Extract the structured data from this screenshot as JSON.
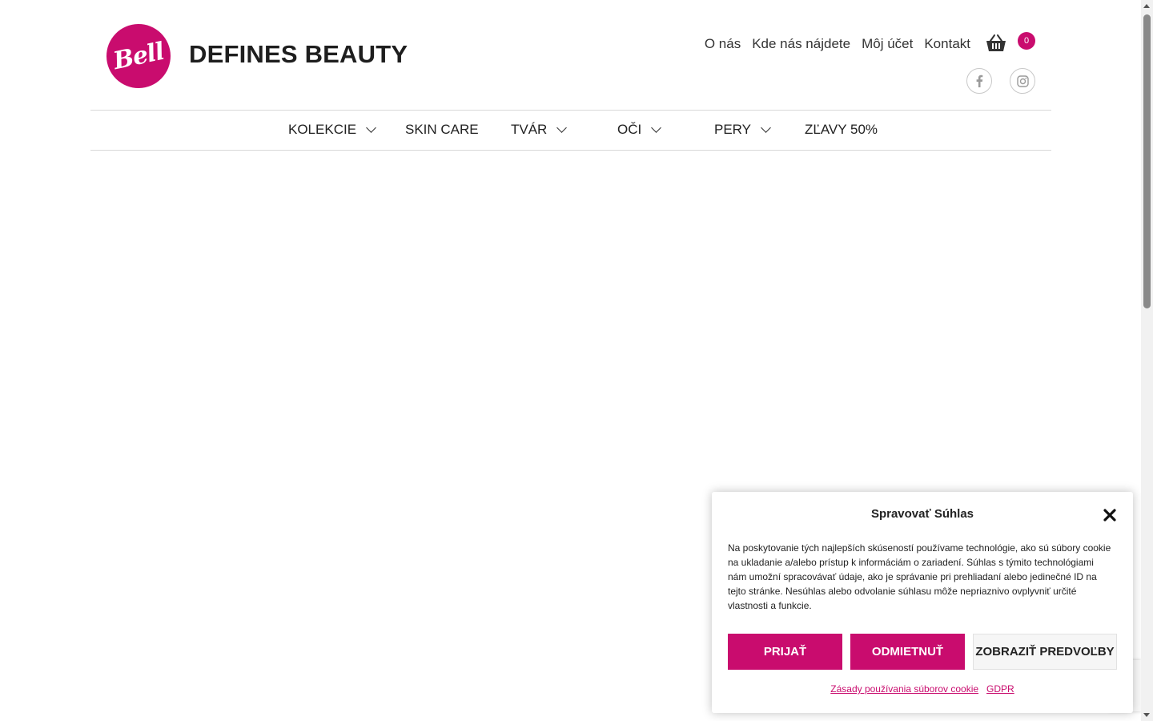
{
  "colors": {
    "accent": "#c90c6e",
    "text": "#222222",
    "border": "#d8d8d8"
  },
  "header": {
    "logo_text": "Bell",
    "brand": "DEFINES BEAUTY",
    "links": [
      "O nás",
      "Kde nás nájdete",
      "Môj účet",
      "Kontakt"
    ],
    "cart_count": "0",
    "social": [
      "facebook-icon",
      "instagram-icon"
    ]
  },
  "nav": {
    "items": [
      {
        "label": "KOLEKCIE",
        "has_dropdown": true
      },
      {
        "label": "SKIN CARE",
        "has_dropdown": false
      },
      {
        "label": "TVÁR",
        "has_dropdown": true
      },
      {
        "label": "OČI",
        "has_dropdown": true
      },
      {
        "label": "PERY",
        "has_dropdown": true
      },
      {
        "label": "ZĽAVY 50%",
        "has_dropdown": false
      }
    ]
  },
  "cookie": {
    "title": "Spravovať Súhlas",
    "text": "Na poskytovanie tých najlepších skúseností používame technológie, ako sú súbory cookie na ukladanie a/alebo prístup k informáciám o zariadení. Súhlas s týmito technológiami nám umožní spracovávať údaje, ako je správanie pri prehliadaní alebo jedinečné ID na tejto stránke. Nesúhlas alebo odvolanie súhlasu môže nepriaznivo ovplyvniť určité vlastnosti a funkcie.",
    "accept_label": "PRIJAŤ",
    "deny_label": "ODMIETNUŤ",
    "prefs_label": "ZOBRAZIŤ PREDVOĽBY",
    "link_cookie_policy": "Zásady používania súborov cookie",
    "link_gdpr": "GDPR"
  }
}
